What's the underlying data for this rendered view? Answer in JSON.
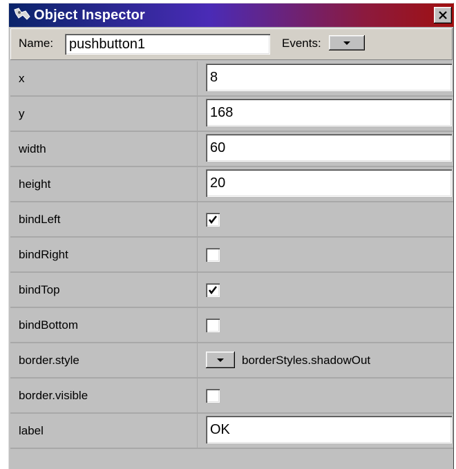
{
  "window": {
    "title": "Object Inspector",
    "icon": "inspector-app-icon",
    "close_icon": "close-icon"
  },
  "header": {
    "name_label": "Name:",
    "name_value": "pushbutton1",
    "events_label": "Events:"
  },
  "properties": [
    {
      "name": "x",
      "type": "text",
      "value": "8"
    },
    {
      "name": "y",
      "type": "text",
      "value": "168"
    },
    {
      "name": "width",
      "type": "text",
      "value": "60"
    },
    {
      "name": "height",
      "type": "text",
      "value": "20"
    },
    {
      "name": "bindLeft",
      "type": "checkbox",
      "checked": true
    },
    {
      "name": "bindRight",
      "type": "checkbox",
      "checked": false
    },
    {
      "name": "bindTop",
      "type": "checkbox",
      "checked": true
    },
    {
      "name": "bindBottom",
      "type": "checkbox",
      "checked": false
    },
    {
      "name": "border.style",
      "type": "dropdown",
      "value": "borderStyles.shadowOut"
    },
    {
      "name": "border.visible",
      "type": "checkbox",
      "checked": false
    },
    {
      "name": "label",
      "type": "text",
      "value": "OK"
    }
  ]
}
